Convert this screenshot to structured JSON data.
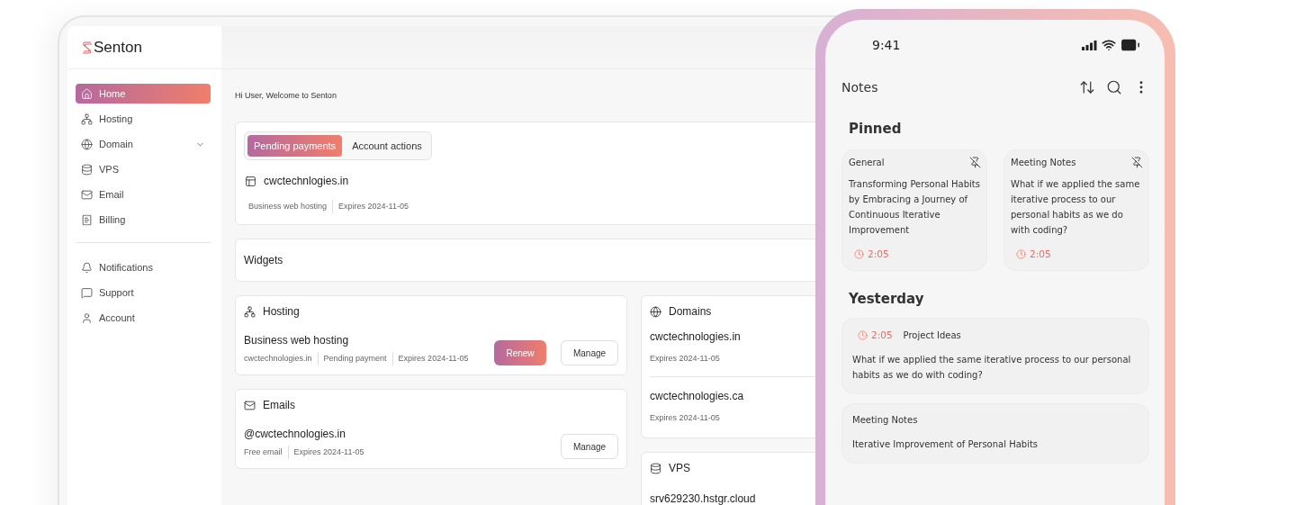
{
  "sidebar": {
    "logo": "Senton",
    "items": [
      {
        "label": "Home",
        "kind": "link",
        "selected": true
      },
      {
        "label": "Hosting",
        "kind": "link",
        "selected": false
      },
      {
        "label": "Domain",
        "kind": "dropdown",
        "selected": false
      },
      {
        "label": "VPS",
        "kind": "link",
        "selected": false
      },
      {
        "label": "Email",
        "kind": "link",
        "selected": false
      },
      {
        "label": "Billing",
        "kind": "link",
        "selected": false
      }
    ],
    "secondary_items": [
      {
        "label": "Notifications",
        "selected": false
      },
      {
        "label": "Support",
        "selected": false
      },
      {
        "label": "Account",
        "selected": false
      }
    ]
  },
  "greeting": "Hi User, Welcome to Senton",
  "overview": {
    "tabs": [
      {
        "label": "Pending payments",
        "selected": true
      },
      {
        "label": "Account actions",
        "selected": false
      }
    ],
    "item": {
      "title": "cwctechnlogies.in",
      "meta": [
        "Business web hosting",
        "Expires 2024-11-05"
      ]
    }
  },
  "widgets": {
    "title": "Widgets"
  },
  "hosting": {
    "title": "Hosting",
    "name": "Business web hosting",
    "meta": [
      "cwctechnologies.in",
      "Pending payment",
      "Expires 2024-11-05"
    ],
    "buttons": [
      {
        "label": "Renew",
        "kind": "primary"
      },
      {
        "label": "Manage",
        "kind": "secondary"
      }
    ]
  },
  "emails": {
    "title": "Emails",
    "name": "@cwctechnologies.in",
    "meta": [
      "Free email",
      "Expires 2024-11-05"
    ],
    "buttons": [
      {
        "label": "Manage",
        "kind": "secondary"
      }
    ]
  },
  "domains": {
    "title": "Domains",
    "items": [
      {
        "name": "cwctechnologies.in",
        "expires": "Expires 2024-11-05"
      },
      {
        "name": "cwctechnologies.ca",
        "expires": "Expires 2024-11-05"
      }
    ]
  },
  "vps": {
    "title": "VPS",
    "items": [
      {
        "name": "srv629230.hstgr.cloud"
      }
    ]
  },
  "phone": {
    "time": "9:41",
    "title": "Notes",
    "sections": [
      {
        "title": "Pinned",
        "kind": "grid",
        "notes": [
          {
            "category": "General",
            "body": "Transforming Personal Habits by Embracing a Journey of Continuous Iterative Improvement",
            "time": "2:05",
            "pinned": true
          },
          {
            "category": "Meeting Notes",
            "body": "What if we applied the same iterative process to our personal habits as we do with coding?",
            "time": "2:05",
            "pinned": true
          }
        ]
      },
      {
        "title": "Yesterday",
        "kind": "list",
        "notes": [
          {
            "category": "Project Ideas",
            "body": "What if we applied the same iterative process to our personal habits as we do with coding?",
            "time": "2:05",
            "pinned": false
          },
          {
            "category": "Meeting Notes",
            "body": "Iterative Improvement of Personal Habits",
            "pinned": false
          }
        ]
      }
    ]
  }
}
